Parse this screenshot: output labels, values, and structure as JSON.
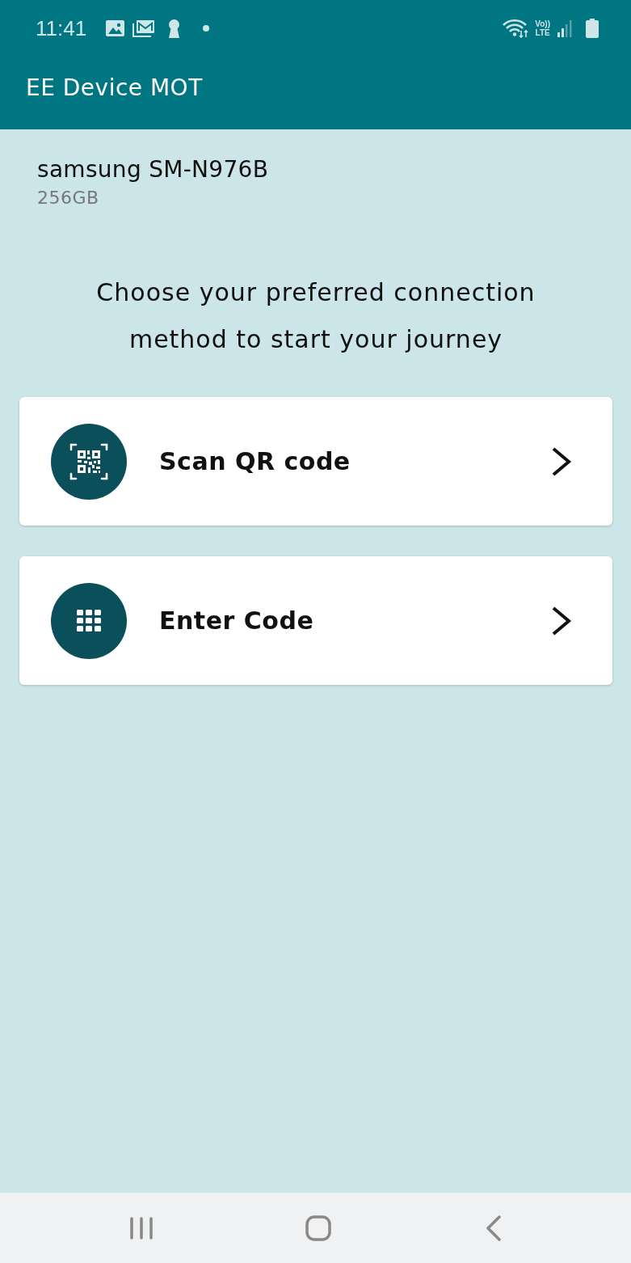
{
  "status_bar": {
    "time": "11:41",
    "network": "Vo)) LTE"
  },
  "app_bar": {
    "title": "EE Device MOT"
  },
  "device": {
    "model": "samsung SM-N976B",
    "storage": "256GB"
  },
  "prompt": "Choose your preferred connection method to start your journey",
  "options": [
    {
      "kind": "qr",
      "label": "Scan QR code"
    },
    {
      "kind": "keypad",
      "label": "Enter Code"
    }
  ]
}
